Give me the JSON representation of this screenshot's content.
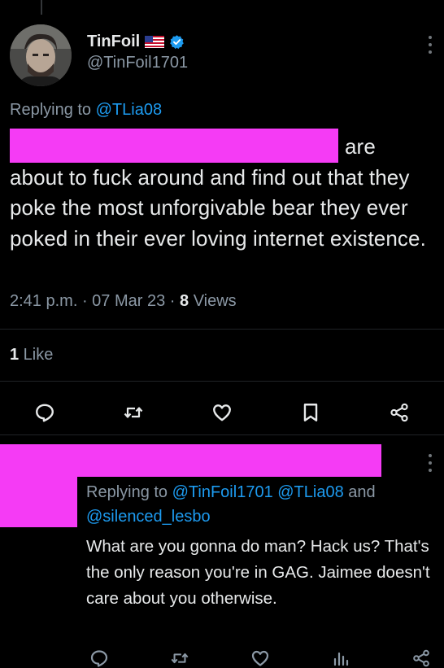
{
  "tweet": {
    "display_name": "TinFoil",
    "handle": "@TinFoil1701",
    "replying_prefix": "Replying to ",
    "replying_to": "@TLia08",
    "text_line1_tail": "are",
    "text_rest": "about to fuck around and find out that they poke the most unforgivable bear they ever poked in their ever loving internet existence.",
    "time": "2:41 p.m.",
    "sep1": " · ",
    "date": "07 Mar 23",
    "sep2": " · ",
    "views_count": "8",
    "views_label": " Views",
    "likes_count": "1",
    "likes_label": " Like",
    "icons": {
      "flag": "us-flag-icon",
      "verified": "verified-badge-icon",
      "more": "more-options-icon",
      "reply": "reply-icon",
      "retweet": "retweet-icon",
      "like": "like-heart-icon",
      "bookmark": "bookmark-icon",
      "share": "share-icon"
    }
  },
  "reply": {
    "replying_prefix": "Replying to ",
    "mention1": "@TinFoil1701",
    "mention2": "@TLia08",
    "joiner": " and",
    "mention3": "@silenced_lesbo",
    "text": "What are you gonna do man? Hack us? That's the only reason you're in GAG. Jaimee doesn't care about you otherwise.",
    "icons": {
      "reply": "reply-icon",
      "retweet": "retweet-icon",
      "like": "like-heart-icon",
      "views": "views-chart-icon",
      "share": "share-icon"
    }
  },
  "colors": {
    "background": "#000000",
    "text": "#e7e9ea",
    "secondary": "#8b98a5",
    "accent": "#1d9bf0",
    "redaction": "#f53bf5"
  }
}
